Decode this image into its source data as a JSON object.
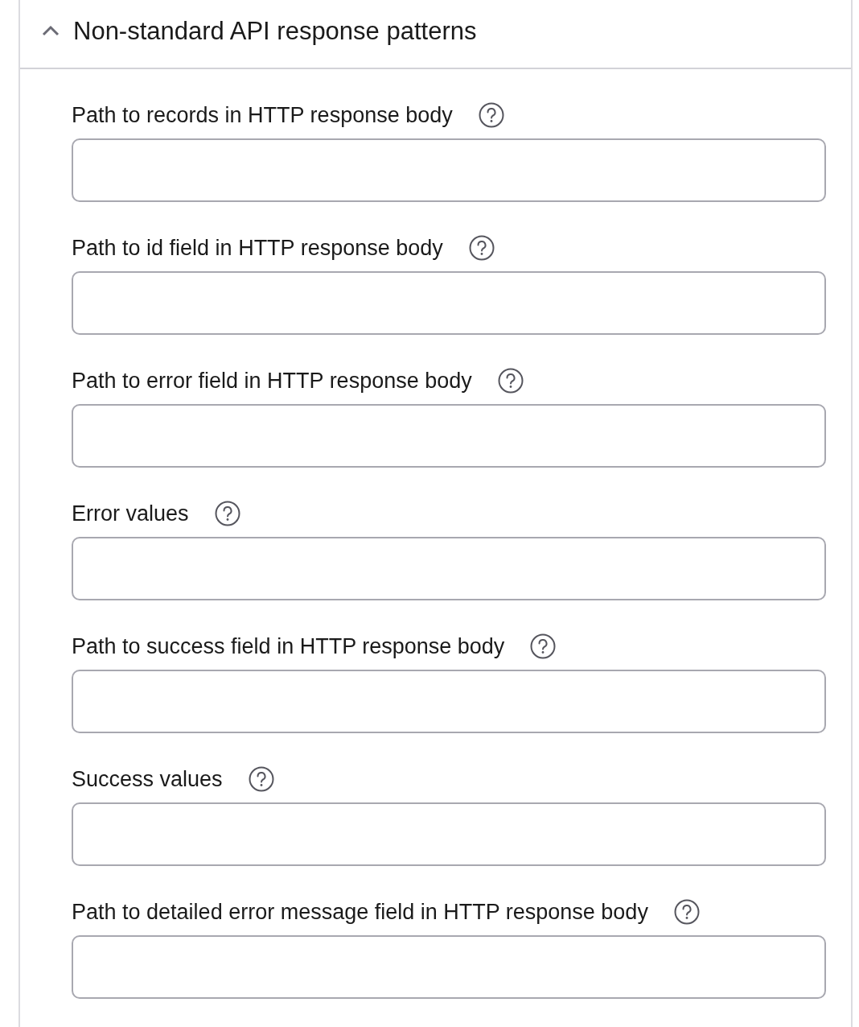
{
  "section": {
    "title": "Non-standard API response patterns",
    "expanded": true
  },
  "fields": [
    {
      "label": "Path to records in HTTP response body"
    },
    {
      "label": "Path to id field in HTTP response body"
    },
    {
      "label": "Path to error field in HTTP response body"
    },
    {
      "label": "Error values"
    },
    {
      "label": "Path to success field in HTTP response body"
    },
    {
      "label": "Success values"
    },
    {
      "label": "Path to detailed error message field in HTTP response body"
    }
  ]
}
